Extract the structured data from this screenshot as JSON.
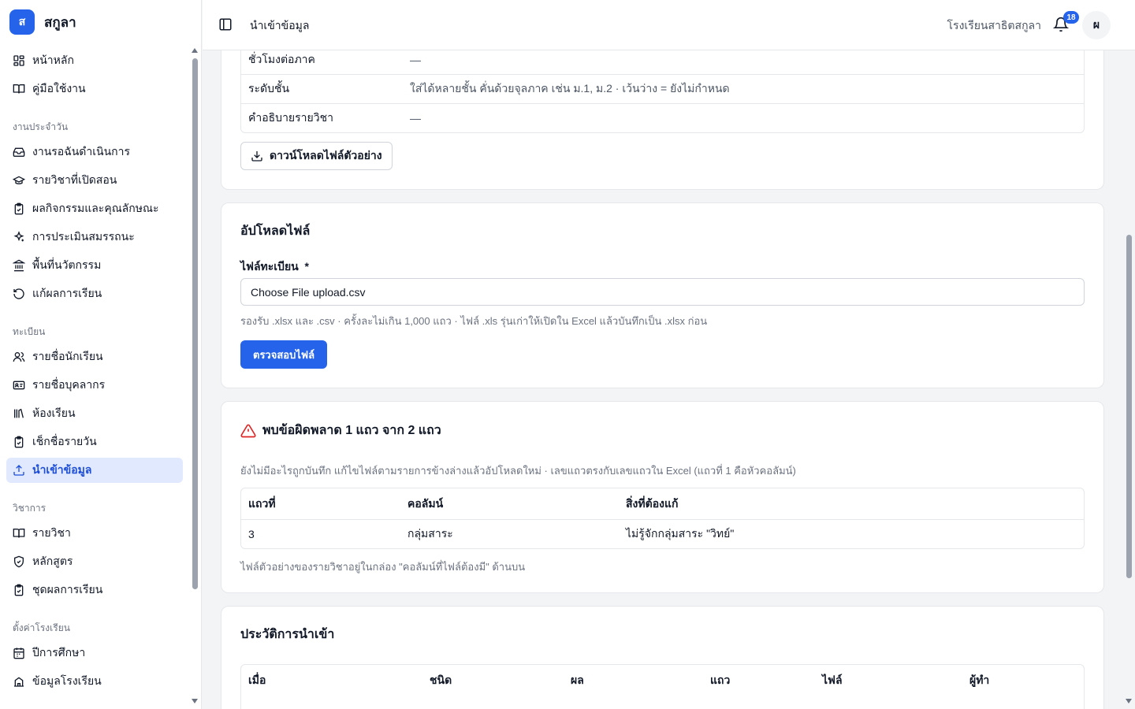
{
  "brand": {
    "logo_letter": "ส",
    "name": "สกูลา"
  },
  "sidebar": {
    "top_items": [
      {
        "label": "หน้าหลัก",
        "icon": "dashboard-icon"
      },
      {
        "label": "คู่มือใช้งาน",
        "icon": "book-open-icon"
      }
    ],
    "groups": [
      {
        "title": "งานประจำวัน",
        "items": [
          {
            "label": "งานรอฉันดำเนินการ",
            "icon": "inbox-icon"
          },
          {
            "label": "รายวิชาที่เปิดสอน",
            "icon": "graduation-cap-icon"
          },
          {
            "label": "ผลกิจกรรมและคุณลักษณะ",
            "icon": "clipboard-check-icon"
          },
          {
            "label": "การประเมินสมรรถนะ",
            "icon": "sparkles-icon"
          },
          {
            "label": "พื้นที่นวัตกรรม",
            "icon": "landmark-icon"
          },
          {
            "label": "แก้ผลการเรียน",
            "icon": "rotate-ccw-icon"
          }
        ]
      },
      {
        "title": "ทะเบียน",
        "items": [
          {
            "label": "รายชื่อนักเรียน",
            "icon": "users-icon"
          },
          {
            "label": "รายชื่อบุคลากร",
            "icon": "id-card-icon"
          },
          {
            "label": "ห้องเรียน",
            "icon": "library-icon"
          },
          {
            "label": "เช็กชื่อรายวัน",
            "icon": "clipboard-check-icon"
          },
          {
            "label": "นำเข้าข้อมูล",
            "icon": "upload-icon",
            "active": true
          }
        ]
      },
      {
        "title": "วิชาการ",
        "items": [
          {
            "label": "รายวิชา",
            "icon": "book-open-icon"
          },
          {
            "label": "หลักสูตร",
            "icon": "shield-check-icon"
          },
          {
            "label": "ชุดผลการเรียน",
            "icon": "clipboard-check-icon"
          }
        ]
      },
      {
        "title": "ตั้งค่าโรงเรียน",
        "items": [
          {
            "label": "ปีการศึกษา",
            "icon": "calendar-icon"
          },
          {
            "label": "ข้อมูลโรงเรียน",
            "icon": "school-icon"
          }
        ]
      }
    ]
  },
  "header": {
    "title": "นำเข้าข้อมูล",
    "school": "โรงเรียนสาธิตสกูลา",
    "notification_count": "18",
    "avatar_letter": "ผ"
  },
  "columns_card": {
    "rows": [
      {
        "key": "ชั่วโมงต่อภาค",
        "value": "—"
      },
      {
        "key": "ระดับชั้น",
        "value": "ใส่ได้หลายชั้น คั่นด้วยจุลภาค เช่น ม.1, ม.2 · เว้นว่าง = ยังไม่กำหนด"
      },
      {
        "key": "คำอธิบายรายวิชา",
        "value": "—"
      }
    ],
    "download_label": "ดาวน์โหลดไฟล์ตัวอย่าง"
  },
  "upload_card": {
    "title": "อัปโหลดไฟล์",
    "field_label": "ไฟล์ทะเบียน",
    "required_mark": "*",
    "file_value": "Choose File upload.csv",
    "helper": "รองรับ .xlsx และ .csv · ครั้งละไม่เกิน 1,000 แถว · ไฟล์ .xls รุ่นเก่าให้เปิดใน Excel แล้วบันทึกเป็น .xlsx ก่อน",
    "submit_label": "ตรวจสอบไฟล์"
  },
  "error_card": {
    "title": "พบข้อผิดพลาด 1 แถว จาก 2 แถว",
    "description": "ยังไม่มีอะไรถูกบันทึก แก้ไขไฟล์ตามรายการข้างล่างแล้วอัปโหลดใหม่ · เลขแถวตรงกับเลขแถวใน Excel (แถวที่ 1 คือหัวคอลัมน์)",
    "headers": [
      "แถวที่",
      "คอลัมน์",
      "สิ่งที่ต้องแก้"
    ],
    "rows": [
      [
        "3",
        "กลุ่มสาระ",
        "ไม่รู้จักกลุ่มสาระ \"วิทย์\""
      ]
    ],
    "footnote": "ไฟล์ตัวอย่างของรายวิชาอยู่ในกล่อง \"คอลัมน์ที่ไฟล์ต้องมี\" ด้านบน"
  },
  "history_card": {
    "title": "ประวัติการนำเข้า",
    "headers": [
      "เมื่อ",
      "ชนิด",
      "ผล",
      "แถว",
      "ไฟล์",
      "ผู้ทำ"
    ]
  },
  "colors": {
    "accent": "#2563eb",
    "active_bg": "#e0e9ff",
    "error": "#dc2626"
  }
}
